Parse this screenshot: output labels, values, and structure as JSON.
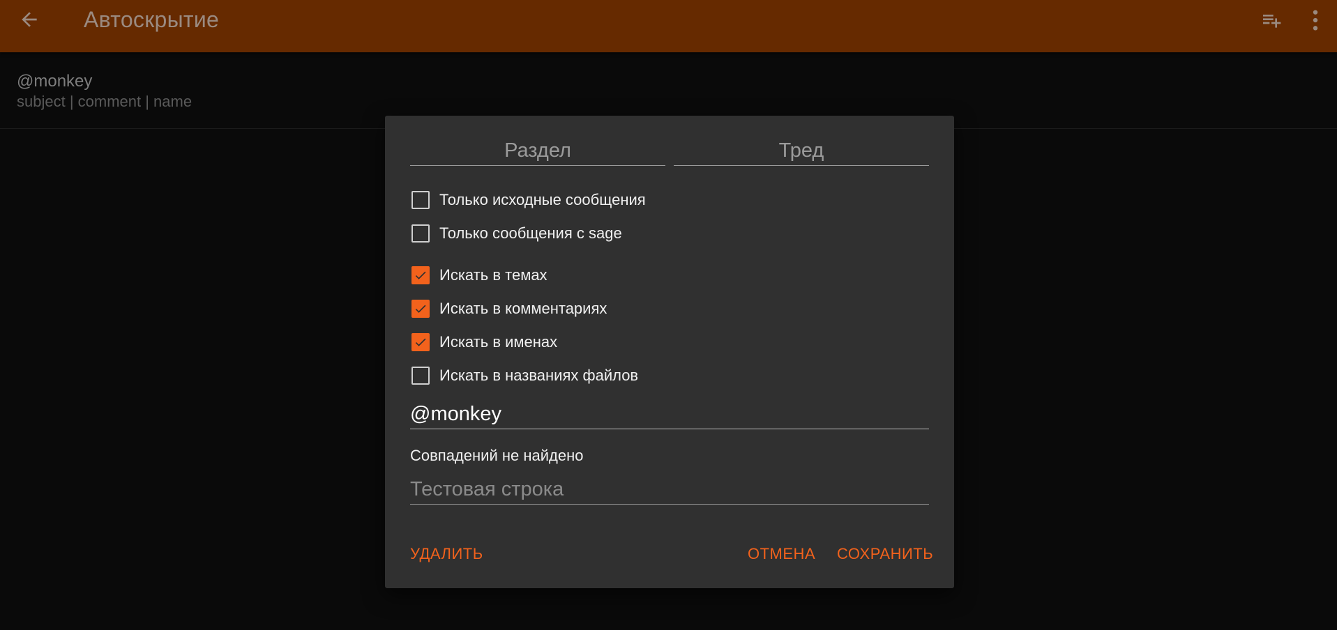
{
  "app_bar": {
    "title": "Автоскрытие",
    "back_icon": "arrow-back-icon",
    "add_icon": "playlist-add-icon",
    "more_icon": "more-vert-icon",
    "background_color": "#662a00"
  },
  "rule_list": {
    "items": [
      {
        "pattern": "@monkey",
        "fields": "subject | comment | name"
      }
    ]
  },
  "dialog": {
    "board_placeholder": "Раздел",
    "thread_placeholder": "Тред",
    "options": [
      {
        "label": "Только исходные сообщения",
        "checked": false
      },
      {
        "label": "Только сообщения с sage",
        "checked": false
      },
      {
        "label": "Искать в темах",
        "checked": true
      },
      {
        "label": "Искать в комментариях",
        "checked": true
      },
      {
        "label": "Искать в именах",
        "checked": true
      },
      {
        "label": "Искать в названиях файлов",
        "checked": false
      }
    ],
    "pattern_value": "@monkey",
    "match_status": "Совпадений не найдено",
    "test_placeholder": "Тестовая строка",
    "buttons": {
      "delete": "УДАЛИТЬ",
      "cancel": "ОТМЕНА",
      "save": "СОХРАНИТЬ"
    },
    "accent_color": "#f2621c"
  }
}
